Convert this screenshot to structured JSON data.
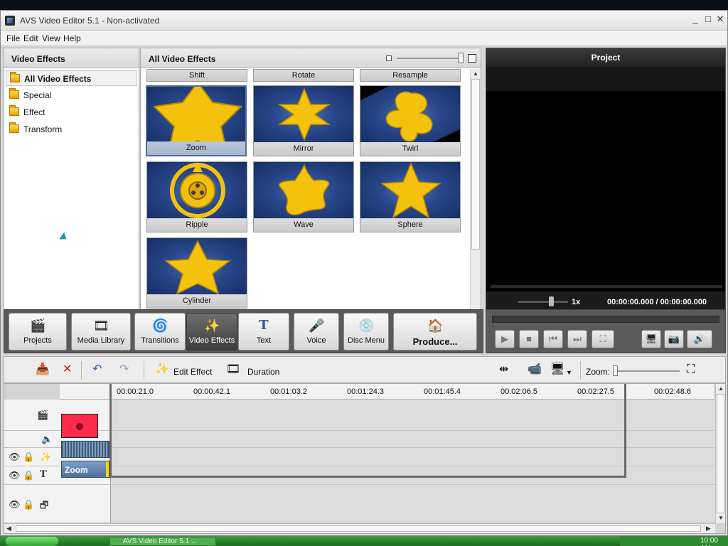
{
  "window": {
    "title": "AVS Video Editor 5.1 - Non-activated",
    "min_glyph": "_",
    "max_glyph": "□",
    "close_glyph": "✕"
  },
  "menu": [
    "File",
    "Edit",
    "View",
    "Help"
  ],
  "left_panel": {
    "title": "Video Effects",
    "items": [
      {
        "label": "All Video Effects",
        "selected": true
      },
      {
        "label": "Special"
      },
      {
        "label": "Effect"
      },
      {
        "label": "Transform"
      }
    ]
  },
  "gallery": {
    "title": "All Video Effects",
    "top_partial": [
      "Shift",
      "Rotate",
      "Resample"
    ],
    "tiles": [
      {
        "label": "Zoom",
        "selected": true,
        "icon": "star-zoom"
      },
      {
        "label": "Mirror",
        "icon": "star-mirror"
      },
      {
        "label": "Twirl",
        "icon": "star-twirl"
      },
      {
        "label": "Ripple",
        "icon": "film-reel-ripple"
      },
      {
        "label": "Wave",
        "icon": "star-wave"
      },
      {
        "label": "Sphere",
        "icon": "star-sphere"
      },
      {
        "label": "Cylinder",
        "icon": "star-cylinder"
      }
    ]
  },
  "preview": {
    "title": "Project",
    "speed": "1x",
    "time": "00:00:00.000 / 00:00:00.000"
  },
  "toolbar": {
    "buttons": [
      {
        "label": "Projects",
        "icon": "clapper-icon"
      },
      {
        "label": "Media Library",
        "icon": "film-strip-icon"
      },
      {
        "label": "Transitions",
        "icon": "spiral-icon"
      },
      {
        "label": "Video Effects",
        "icon": "star-magic-icon",
        "active": true
      },
      {
        "label": "Text",
        "icon": "text-t-icon"
      },
      {
        "label": "Voice",
        "icon": "microphone-icon"
      },
      {
        "label": "Disc Menu",
        "icon": "disc-menu-icon"
      },
      {
        "label": "Produce...",
        "icon": "produce-icon"
      }
    ]
  },
  "player": {
    "buttons": [
      "play-icon",
      "stop-icon",
      "previous-icon",
      "next-icon",
      "fullscreen-icon",
      "monitor-icon",
      "snapshot-icon",
      "volume-icon"
    ]
  },
  "timeline_toolbar": {
    "edit_effect": "Edit Effect",
    "duration": "Duration",
    "zoom_label": "Zoom:"
  },
  "timeline": {
    "ticks": [
      "00:00:21.0",
      "00:00:42.1",
      "00:01:03.2",
      "00:01:24.3",
      "00:01:45.4",
      "00:02:06.5",
      "00:02:27.5",
      "00:02:48.6"
    ],
    "effect_clip": "Zoom"
  },
  "taskbar": {
    "task_label": "AVS Video Editor 5.1 ...",
    "clock": "10:00 AM"
  },
  "colors": {
    "accent": "#4d6f9c",
    "preview_bg": "#000000",
    "toolbar_bg": "#5a5a5a",
    "star": "#f4c20d",
    "clip_red": "#ff2a4a"
  }
}
